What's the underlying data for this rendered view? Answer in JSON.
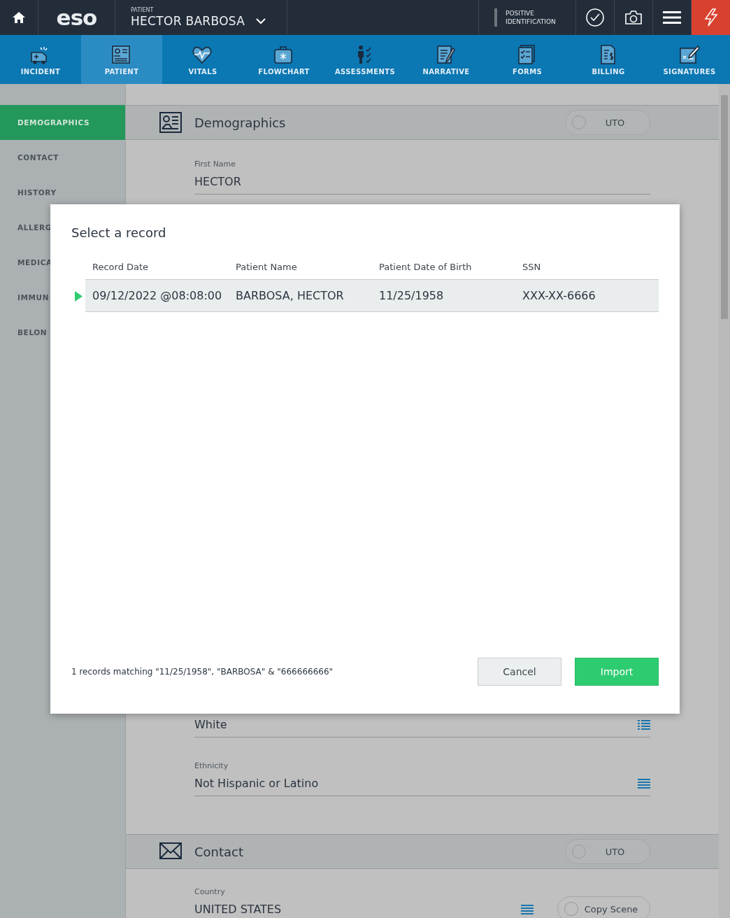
{
  "header": {
    "logo": "eso",
    "patient_label": "PATIENT",
    "patient_name": "HECTOR BARBOSA",
    "positive_id": "POSITIVE IDENTIFICATION"
  },
  "nav": [
    {
      "label": "INCIDENT",
      "selected": false
    },
    {
      "label": "PATIENT",
      "selected": true
    },
    {
      "label": "VITALS",
      "selected": false
    },
    {
      "label": "FLOWCHART",
      "selected": false
    },
    {
      "label": "ASSESSMENTS",
      "selected": false
    },
    {
      "label": "NARRATIVE",
      "selected": false
    },
    {
      "label": "FORMS",
      "selected": false
    },
    {
      "label": "BILLING",
      "selected": false
    },
    {
      "label": "SIGNATURES",
      "selected": false
    }
  ],
  "sidebar": {
    "items": [
      {
        "label": "DEMOGRAPHICS",
        "selected": true
      },
      {
        "label": "CONTACT",
        "selected": false
      },
      {
        "label": "HISTORY",
        "selected": false
      },
      {
        "label": "ALLERG",
        "selected": false
      },
      {
        "label": "MEDICA",
        "selected": false
      },
      {
        "label": "IMMUN",
        "selected": false
      },
      {
        "label": "BELON",
        "selected": false
      }
    ]
  },
  "sections": [
    {
      "title": "Demographics",
      "uto": {
        "label": "UTO",
        "on": false
      },
      "fields": [
        {
          "kind": "text",
          "label": "First Name",
          "value": "HECTOR"
        },
        {
          "kind": "multi",
          "value": "White"
        },
        {
          "kind": "single",
          "label": "Ethnicity",
          "value": "Not Hispanic or Latino"
        }
      ]
    },
    {
      "title": "Contact",
      "uto": {
        "label": "UTO",
        "on": false
      },
      "fields": [
        {
          "kind": "single",
          "label": "Country",
          "value": "UNITED STATES",
          "toggle": {
            "label": "Copy Scene",
            "on": false
          }
        }
      ]
    }
  ],
  "dialog": {
    "title": "Select a record",
    "columns": [
      "Record Date",
      "Patient Name",
      "Patient Date of Birth",
      "SSN"
    ],
    "rows": [
      {
        "cells": [
          "09/12/2022 @08:08:00",
          "BARBOSA, HECTOR",
          "11/25/1958",
          "XXX-XX-6666"
        ],
        "selected": true
      }
    ],
    "footer_text": "1 records matching \"11/25/1958\", \"BARBOSA\" & \"666666666\"",
    "buttons": [
      {
        "label": "Cancel",
        "kind": "secondary"
      },
      {
        "label": "Import",
        "kind": "primary"
      }
    ]
  }
}
